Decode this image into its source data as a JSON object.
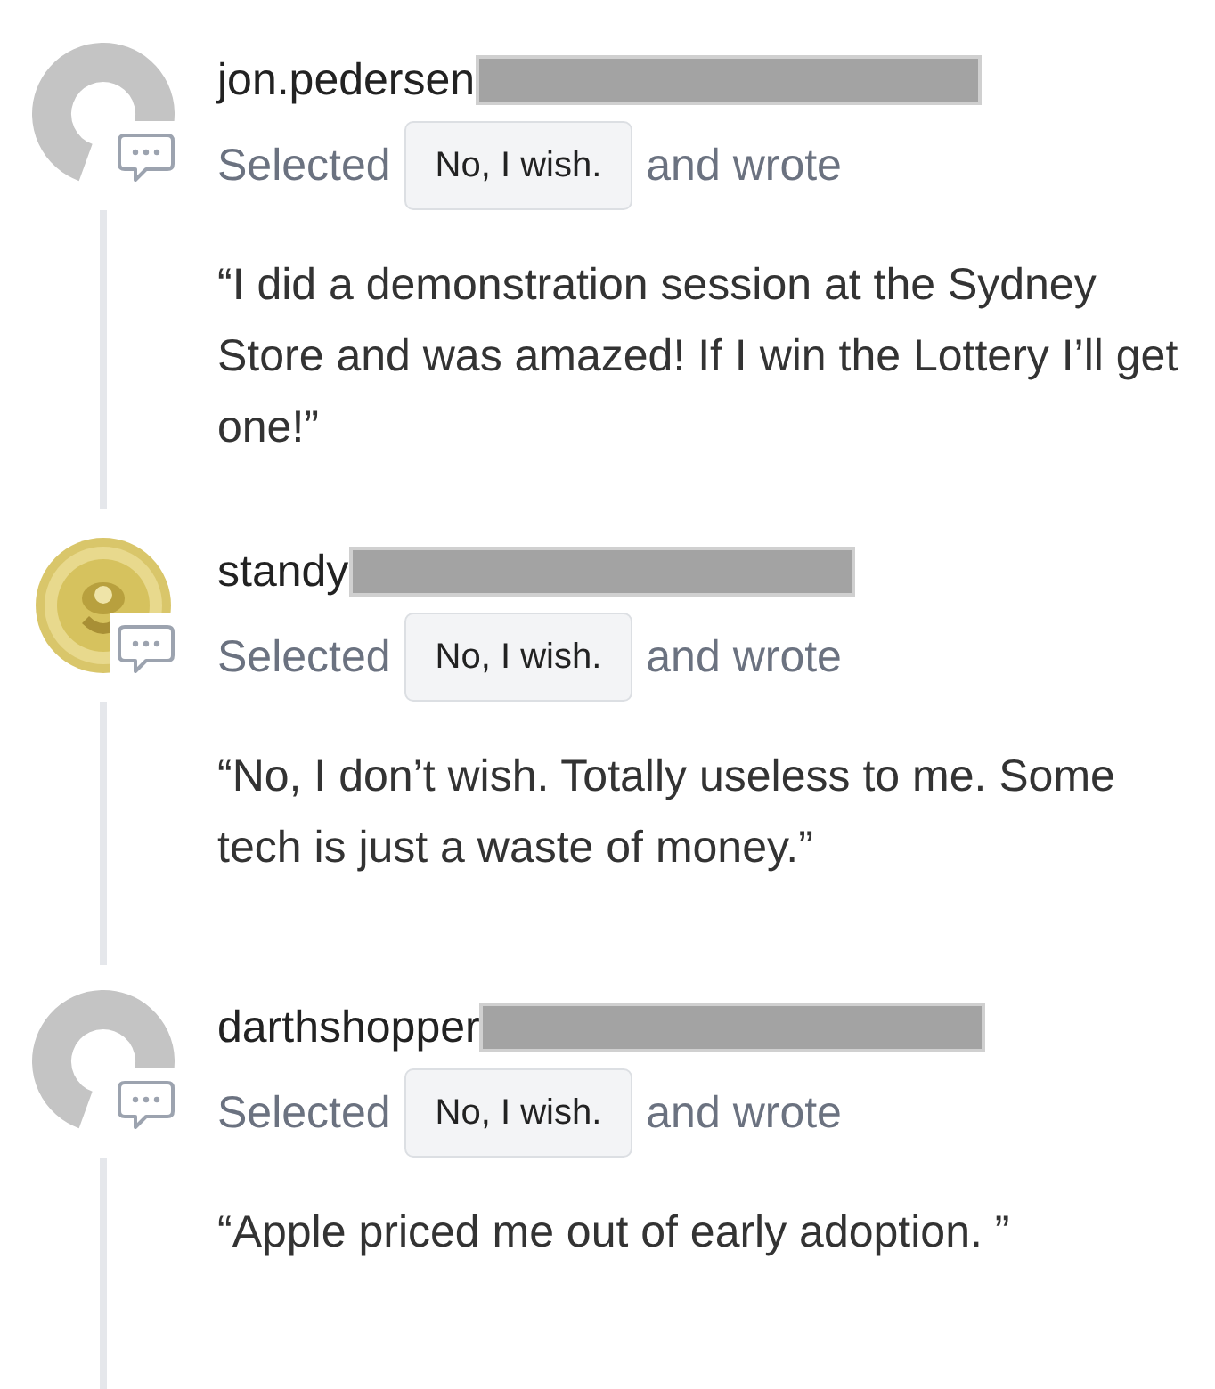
{
  "posts": [
    {
      "username": "jon.pedersen",
      "redacted": true,
      "avatar": {
        "kind": "default"
      },
      "selected_label": "Selected",
      "choice": "No, I wish.",
      "suffix": "and wrote",
      "quote": "“I did a demonstration session at the Sydney Store and was amazed! If I win the Lottery I’ll get one!”"
    },
    {
      "username": "standy",
      "redacted": true,
      "selected_label": "Selected",
      "choice": "No, I wish.",
      "suffix": "and wrote",
      "quote": "“No, I don’t wish. Totally useless to me. Some tech is just a waste of money.”"
    },
    {
      "username": "darthshopper",
      "redacted": true,
      "avatar": {
        "kind": "default"
      },
      "selected_label": "Selected",
      "choice": "No, I wish.",
      "suffix": "and wrote",
      "quote": "“Apple priced me out of early adoption. ”"
    }
  ]
}
